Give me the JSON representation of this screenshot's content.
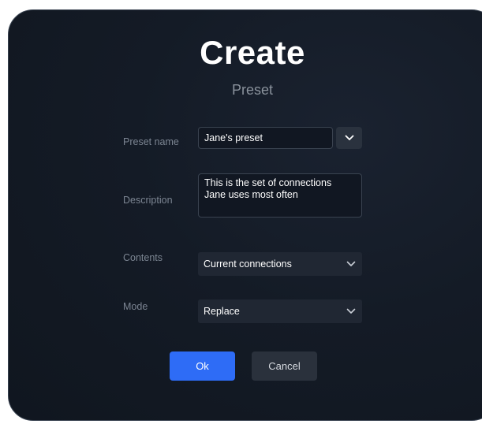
{
  "dialog": {
    "title": "Create",
    "subtitle": "Preset"
  },
  "form": {
    "preset_name": {
      "label": "Preset name",
      "value": "Jane's preset"
    },
    "description": {
      "label": "Description",
      "value": "This is the set of connections\nJane uses most often"
    },
    "contents": {
      "label": "Contents",
      "selected": "Current connections"
    },
    "mode": {
      "label": "Mode",
      "selected": "Replace"
    }
  },
  "actions": {
    "ok_label": "Ok",
    "cancel_label": "Cancel"
  },
  "colors": {
    "primary_button": "#2e6cf6",
    "background": "#141b26"
  },
  "icons": {
    "dropdown": "chevron-down-icon"
  }
}
